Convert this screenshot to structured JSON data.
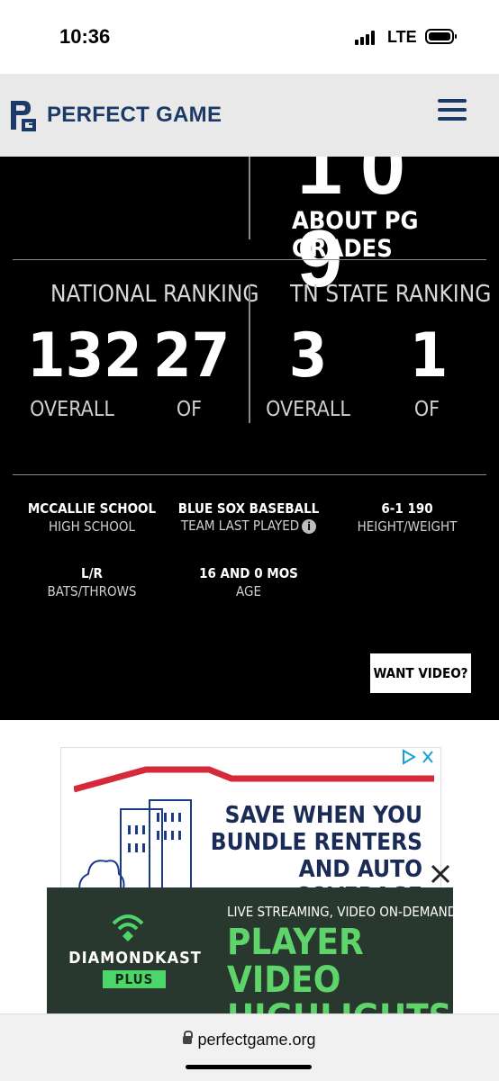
{
  "status_bar": {
    "time": "10:36",
    "network": "LTE"
  },
  "header": {
    "brand": "PERFECT GAME",
    "menu_icon": "hamburger-menu-icon"
  },
  "grades": {
    "fragment": "10 9",
    "about_link": "ABOUT PG GRADES"
  },
  "rankings": {
    "national": {
      "title": "NATIONAL RANKING",
      "overall_value": "132",
      "overall_label": "OVERALL",
      "position_value": "27",
      "position_label": "OF"
    },
    "state": {
      "title": "TN STATE RANKING",
      "overall_value": "3",
      "overall_label": "OVERALL",
      "position_value": "1",
      "position_label": "OF"
    }
  },
  "player_info": {
    "school": {
      "value": "MCCALLIE SCHOOL",
      "label": "HIGH SCHOOL"
    },
    "team": {
      "value": "BLUE SOX BASEBALL",
      "label": "TEAM LAST PLAYED",
      "info_glyph": "i"
    },
    "height_weight": {
      "value": "6-1  190",
      "label": "HEIGHT/WEIGHT"
    },
    "bats_throws": {
      "value": "L/R",
      "label": "BATS/THROWS"
    },
    "age": {
      "value": "16 AND 0 MOS",
      "label": "AGE"
    }
  },
  "want_video_button": "WANT VIDEO?",
  "ad": {
    "text_lines": [
      "SAVE WHEN YOU",
      "BUNDLE RENTERS",
      "AND AUTO COVERAGE"
    ],
    "adchoices_icon": "adchoices-icon",
    "close_icon": "close-icon"
  },
  "video_banner": {
    "brand": "DIAMONDKAST",
    "brand_tag": "PLUS",
    "tagline": "LIVE STREAMING, VIDEO ON-DEMAND +",
    "headline_1": "PLAYER VIDEO",
    "headline_2": "HIGHLIGHTS"
  },
  "browser": {
    "url": "perfectgame.org"
  },
  "colors": {
    "brand_navy": "#1b3a68",
    "banner_green": "#5fd46a",
    "ad_red": "#d6293a"
  }
}
